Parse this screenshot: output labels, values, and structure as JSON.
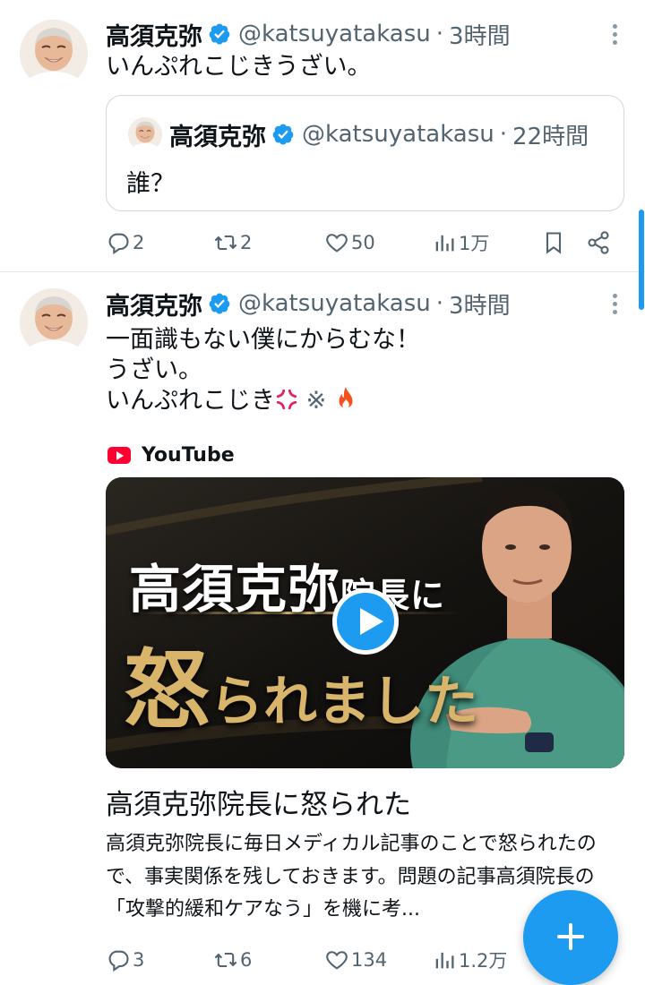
{
  "tweets": [
    {
      "display_name": "高須克弥",
      "handle": "@katsuyatakasu",
      "separator": "·",
      "time": "3時間",
      "text": "いんぷれこじきうざい。",
      "quote": {
        "display_name": "高須克弥",
        "handle": "@katsuyatakasu",
        "separator": "·",
        "time": "22時間",
        "text": "誰？"
      },
      "actions": {
        "replies": "2",
        "retweets": "2",
        "likes": "50",
        "views": "1万"
      }
    },
    {
      "display_name": "高須克弥",
      "handle": "@katsuyatakasu",
      "separator": "·",
      "time": "3時間",
      "text_lines": [
        "一面識もない僕にからむな！",
        "うざい。",
        "いんぷれこじき"
      ],
      "emoji_symbol": "※",
      "card": {
        "source": "YouTube",
        "thumb_line1_main": "高須克弥",
        "thumb_line1_small": "院長に",
        "thumb_line2_big": "怒",
        "thumb_line2_rest": "られました",
        "title": "高須克弥院長に怒られた",
        "description": "高須克弥院長に毎日メディカル記事のことで怒られたので、事実関係を残しておきます。問題の記事高須院長の「攻撃的緩和ケアなう」を機に考..."
      },
      "actions": {
        "replies": "3",
        "retweets": "6",
        "likes": "134",
        "views": "1.2万"
      }
    }
  ],
  "icons": {
    "verified": "verified-badge-icon",
    "reply": "reply-icon",
    "retweet": "retweet-icon",
    "like": "heart-icon",
    "views": "views-icon",
    "bookmark": "bookmark-icon",
    "share": "share-icon",
    "compose": "plus-icon"
  },
  "colors": {
    "accent": "#1d9bf0",
    "text": "#0f1419",
    "muted": "#536471",
    "youtube": "#ff0033",
    "gold": "#d8b56a"
  }
}
